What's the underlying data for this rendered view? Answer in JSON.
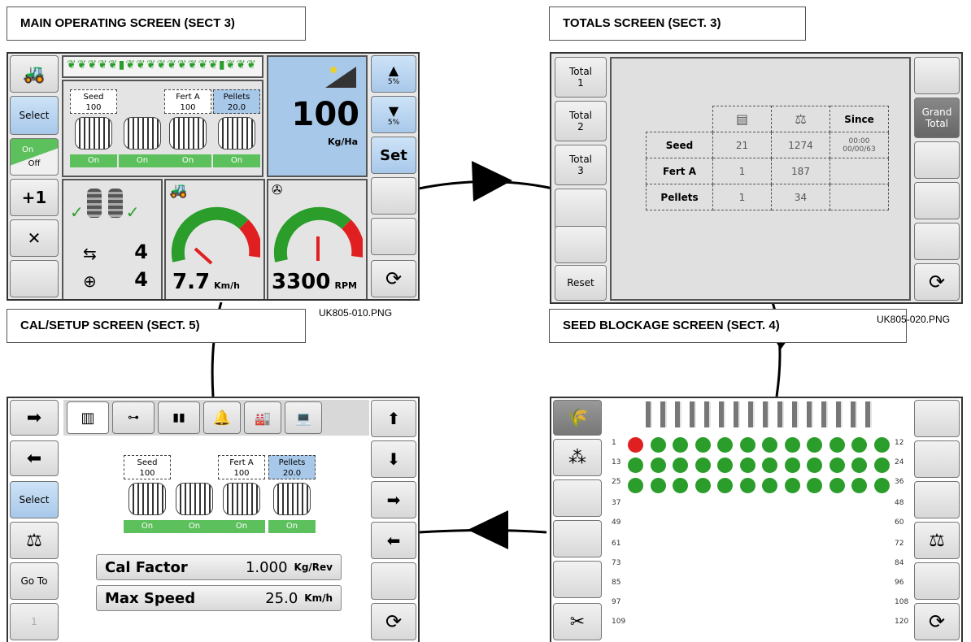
{
  "titles": {
    "main": "MAIN OPERATING SCREEN (SECT 3)",
    "totals": "TOTALS SCREEN (SECT. 3)",
    "cal": "CAL/SETUP SCREEN (SECT. 5)",
    "seed": "SEED BLOCKAGE SCREEN (SECT. 4)"
  },
  "captions": {
    "main": "UK805-010.PNG",
    "totals": "UK805-020.PNG"
  },
  "main": {
    "select": "Select",
    "on": "On",
    "off": "Off",
    "plus1": "+1",
    "rate": "100",
    "rate_unit": "Kg/Ha",
    "up_pct": "5%",
    "down_pct": "5%",
    "set": "Set",
    "tramline_count": "4",
    "target_count": "4",
    "speed": "7.7",
    "speed_unit": "Km/h",
    "rpm": "3300",
    "rpm_unit": "RPM",
    "products": [
      {
        "name": "Seed",
        "value": "100",
        "state": "On"
      },
      {
        "name": "Fert A",
        "value": "100",
        "state": "On"
      },
      {
        "name": "Pellets",
        "value": "20.0",
        "state": "On"
      }
    ]
  },
  "totals": {
    "buttons": [
      "Total\n1",
      "Total\n2",
      "Total\n3"
    ],
    "reset": "Reset",
    "grand": "Grand\nTotal",
    "since": "Since",
    "rows": [
      {
        "name": "Seed",
        "a": "21",
        "b": "1274",
        "c": "00:00\n00/00/63"
      },
      {
        "name": "Fert A",
        "a": "1",
        "b": "187",
        "c": ""
      },
      {
        "name": "Pellets",
        "a": "1",
        "b": "34",
        "c": ""
      }
    ]
  },
  "cal": {
    "select": "Select",
    "goto": "Go To",
    "page": "1",
    "cal_factor_label": "Cal Factor",
    "cal_factor_value": "1.000",
    "cal_factor_unit": "Kg/Rev",
    "max_speed_label": "Max Speed",
    "max_speed_value": "25.0",
    "max_speed_unit": "Km/h"
  },
  "seed": {
    "row_labels_left": [
      "1",
      "13",
      "25",
      "37",
      "49",
      "61",
      "73",
      "85",
      "97",
      "109"
    ],
    "row_labels_right": [
      "12",
      "24",
      "36",
      "48",
      "60",
      "72",
      "84",
      "96",
      "108",
      "120"
    ]
  },
  "colors": {
    "green": "#2a9d2a",
    "red": "#e02020",
    "select_blue": "#a8c8ea",
    "meter_green": "#5cc05c"
  }
}
